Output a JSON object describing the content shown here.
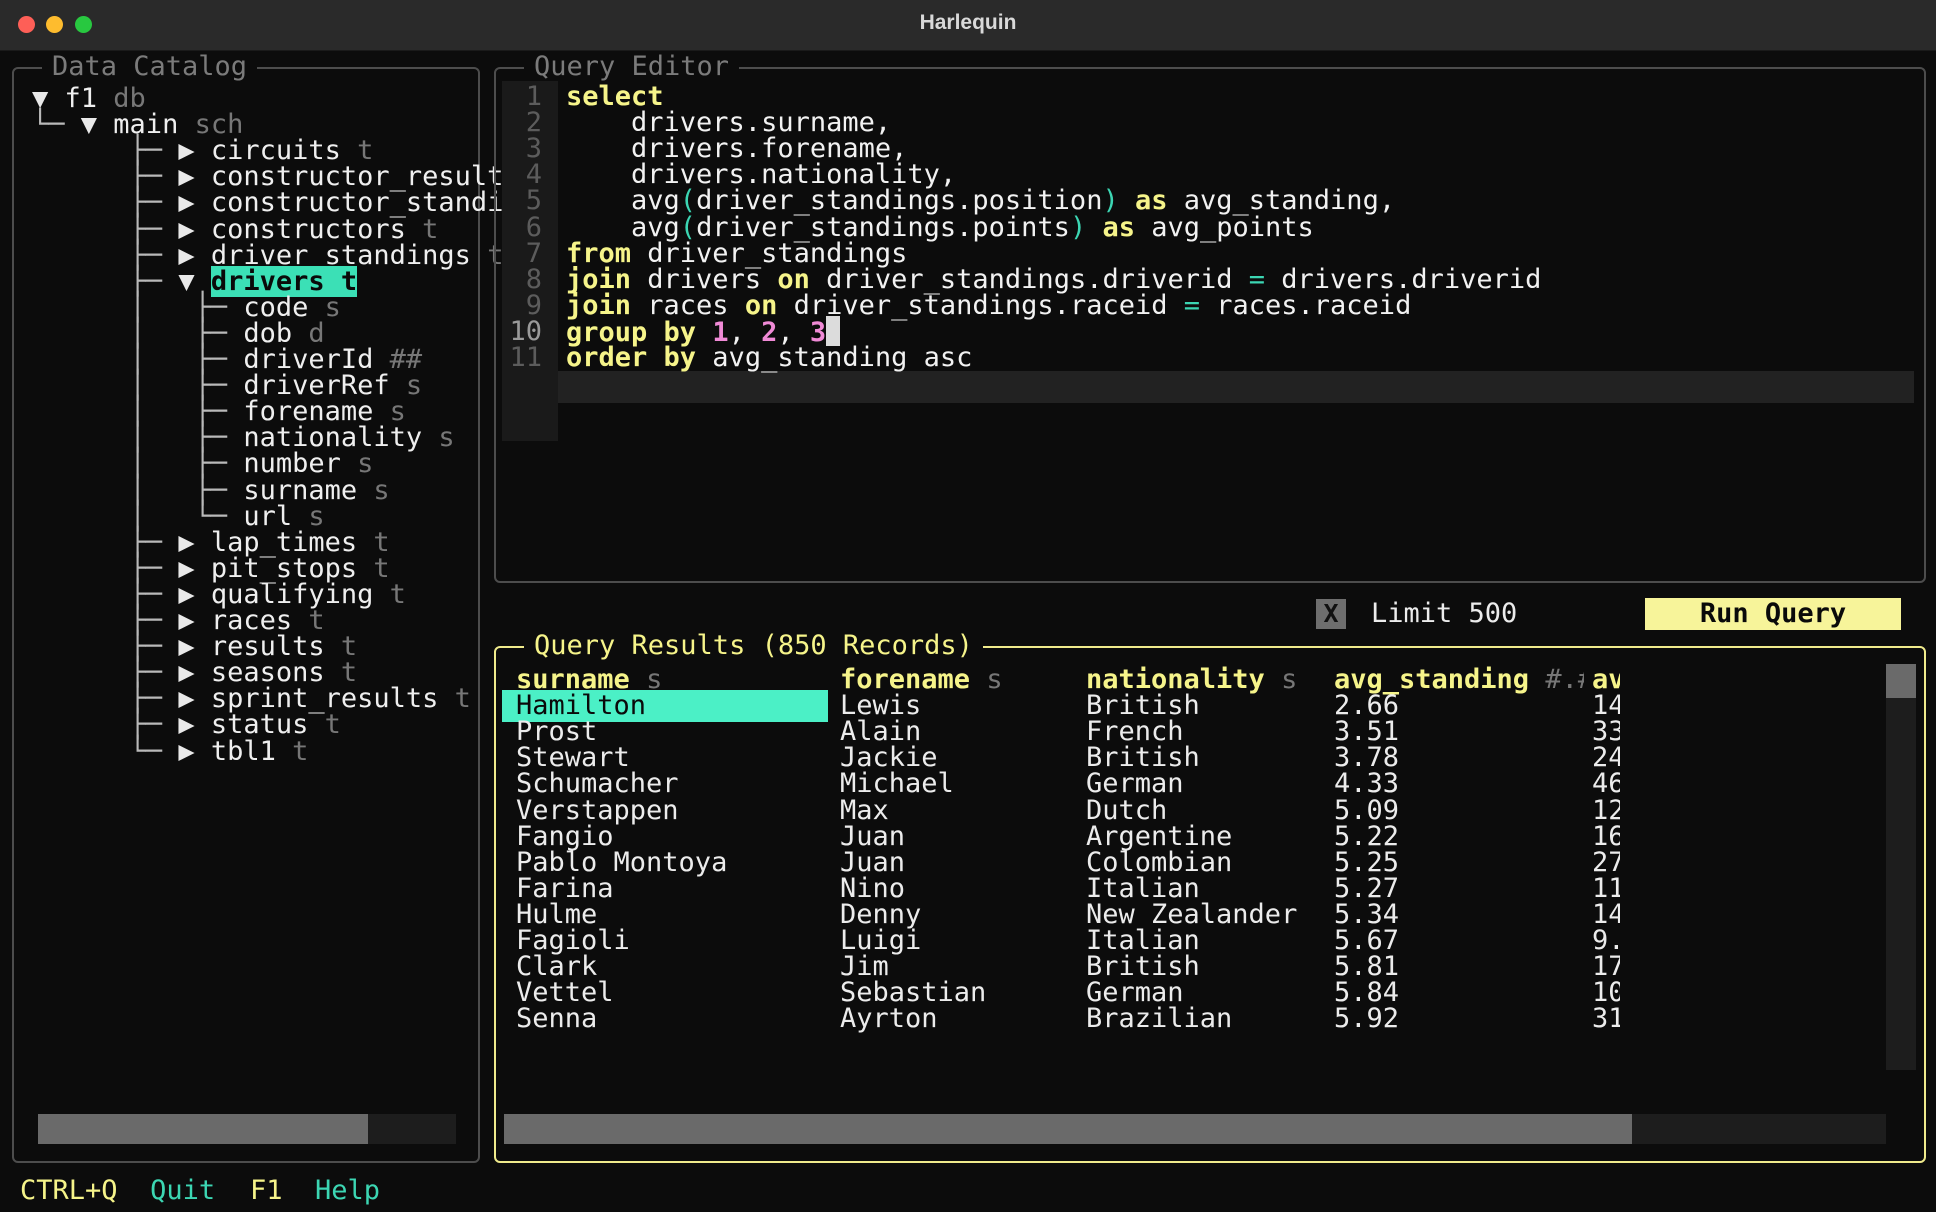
{
  "window": {
    "title": "Harlequin"
  },
  "catalog": {
    "title": "Data Catalog",
    "db": {
      "name": "f1",
      "type": "db"
    },
    "schema": {
      "name": "main",
      "type": "sch"
    },
    "tables_before": [
      {
        "name": "circuits",
        "type": "t"
      },
      {
        "name": "constructor_result",
        "type": ""
      },
      {
        "name": "constructor_standi",
        "type": ""
      },
      {
        "name": "constructors",
        "type": "t"
      },
      {
        "name": "driver_standings",
        "type": "t"
      }
    ],
    "selected_table": {
      "name": "drivers",
      "type": "t"
    },
    "columns": [
      {
        "name": "code",
        "type": "s"
      },
      {
        "name": "dob",
        "type": "d"
      },
      {
        "name": "driverId",
        "type": "##"
      },
      {
        "name": "driverRef",
        "type": "s"
      },
      {
        "name": "forename",
        "type": "s"
      },
      {
        "name": "nationality",
        "type": "s"
      },
      {
        "name": "number",
        "type": "s"
      },
      {
        "name": "surname",
        "type": "s"
      },
      {
        "name": "url",
        "type": "s"
      }
    ],
    "tables_after": [
      {
        "name": "lap_times",
        "type": "t"
      },
      {
        "name": "pit_stops",
        "type": "t"
      },
      {
        "name": "qualifying",
        "type": "t"
      },
      {
        "name": "races",
        "type": "t"
      },
      {
        "name": "results",
        "type": "t"
      },
      {
        "name": "seasons",
        "type": "t"
      },
      {
        "name": "sprint_results",
        "type": "t"
      },
      {
        "name": "status",
        "type": "t"
      },
      {
        "name": "tbl1",
        "type": "t"
      }
    ]
  },
  "editor": {
    "title": "Query Editor",
    "lines": [
      [
        [
          "kw",
          "select"
        ]
      ],
      [
        [
          "pl",
          "    drivers.surname,"
        ]
      ],
      [
        [
          "pl",
          "    drivers.forename,"
        ]
      ],
      [
        [
          "pl",
          "    drivers.nationality,"
        ]
      ],
      [
        [
          "pl",
          "    avg"
        ],
        [
          "pn",
          "("
        ],
        [
          "pl",
          "driver_standings.position"
        ],
        [
          "pn",
          ")"
        ],
        [
          "pl",
          " "
        ],
        [
          "kw",
          "as"
        ],
        [
          "pl",
          " avg_standing,"
        ]
      ],
      [
        [
          "pl",
          "    avg"
        ],
        [
          "pn",
          "("
        ],
        [
          "pl",
          "driver_standings.points"
        ],
        [
          "pn",
          ")"
        ],
        [
          "pl",
          " "
        ],
        [
          "kw",
          "as"
        ],
        [
          "pl",
          " avg_points"
        ]
      ],
      [
        [
          "kw",
          "from"
        ],
        [
          "pl",
          " driver_standings"
        ]
      ],
      [
        [
          "kw",
          "join"
        ],
        [
          "pl",
          " drivers "
        ],
        [
          "kw",
          "on"
        ],
        [
          "pl",
          " driver_standings.driverid "
        ],
        [
          "pn",
          "="
        ],
        [
          "pl",
          " drivers.driverid"
        ]
      ],
      [
        [
          "kw",
          "join"
        ],
        [
          "pl",
          " races "
        ],
        [
          "kw",
          "on"
        ],
        [
          "pl",
          " driver_standings.raceid "
        ],
        [
          "pn",
          "="
        ],
        [
          "pl",
          " races.raceid"
        ]
      ],
      [
        [
          "kw",
          "group by"
        ],
        [
          "pl",
          " "
        ],
        [
          "np",
          "1"
        ],
        [
          "pl",
          ", "
        ],
        [
          "np",
          "2"
        ],
        [
          "pl",
          ", "
        ],
        [
          "np",
          "3"
        ]
      ],
      [
        [
          "kw",
          "order by"
        ],
        [
          "pl",
          " avg_standing asc"
        ]
      ]
    ],
    "current_line": 10
  },
  "controls": {
    "limit_checkbox": "X",
    "limit_label": "Limit 500",
    "run_label": "Run Query"
  },
  "results": {
    "title": "Query Results (850 Records)",
    "columns": [
      {
        "name": "surname",
        "type": "s"
      },
      {
        "name": "forename",
        "type": "s"
      },
      {
        "name": "nationality",
        "type": "s"
      },
      {
        "name": "avg_standing",
        "type": "#.#"
      },
      {
        "name": "av",
        "type": ""
      }
    ],
    "rows": [
      [
        "Hamilton",
        "Lewis",
        "British",
        "2.66",
        "14"
      ],
      [
        "Prost",
        "Alain",
        "French",
        "3.51",
        "33"
      ],
      [
        "Stewart",
        "Jackie",
        "British",
        "3.78",
        "24"
      ],
      [
        "Schumacher",
        "Michael",
        "German",
        "4.33",
        "46"
      ],
      [
        "Verstappen",
        "Max",
        "Dutch",
        "5.09",
        "12"
      ],
      [
        "Fangio",
        "Juan",
        "Argentine",
        "5.22",
        "16"
      ],
      [
        "Pablo Montoya",
        "Juan",
        "Colombian",
        "5.25",
        "27"
      ],
      [
        "Farina",
        "Nino",
        "Italian",
        "5.27",
        "11"
      ],
      [
        "Hulme",
        "Denny",
        "New Zealander",
        "5.34",
        "14"
      ],
      [
        "Fagioli",
        "Luigi",
        "Italian",
        "5.67",
        "9."
      ],
      [
        "Clark",
        "Jim",
        "British",
        "5.81",
        "17"
      ],
      [
        "Vettel",
        "Sebastian",
        "German",
        "5.84",
        "10"
      ],
      [
        "Senna",
        "Ayrton",
        "Brazilian",
        "5.92",
        "31"
      ]
    ]
  },
  "footer": [
    {
      "key": "CTRL+Q",
      "label": "Quit"
    },
    {
      "key": "F1",
      "label": "Help"
    }
  ],
  "colors": {
    "accent": "#3be0b6",
    "keyword": "#f6f48a",
    "number": "#f08ad6",
    "results_border": "#f0eb8c"
  }
}
